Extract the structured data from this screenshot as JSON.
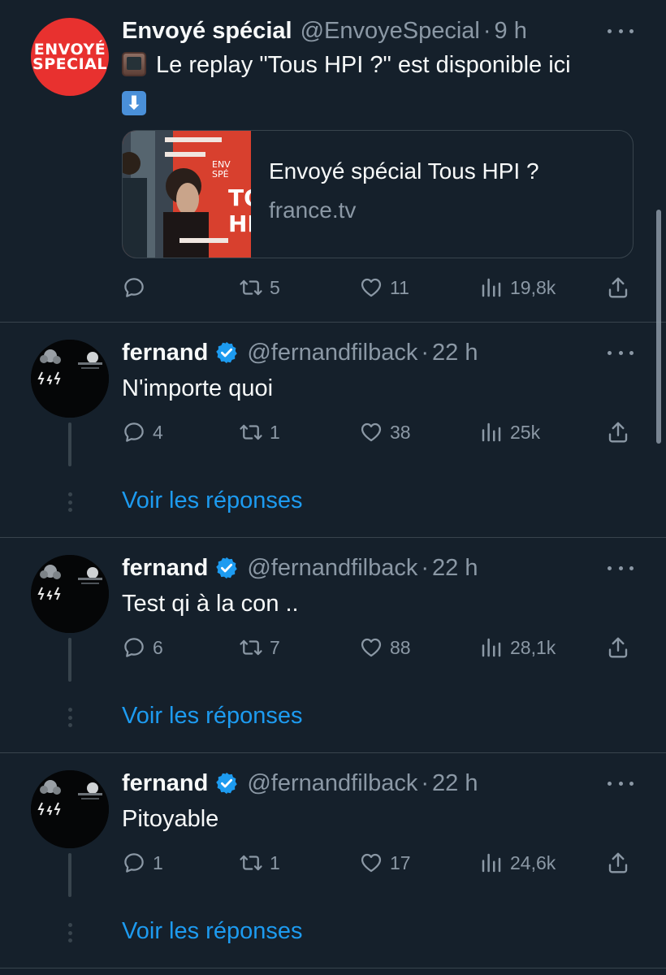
{
  "tweet": {
    "author_name": "Envoyé spécial",
    "handle": "@EnvoyeSpecial",
    "dot": "·",
    "time": "9 h",
    "avatar_text": [
      "ENVOYÉ",
      "SPECIAL"
    ],
    "text": "Le replay \"Tous HPI ?\" est disponible ici",
    "emoji_tv_icon": "television-icon",
    "emoji_arrow": "⬇",
    "card": {
      "title": "Envoyé spécial Tous HPI ?",
      "domain": "france.tv",
      "thumb_text": [
        "ENV",
        "SPÉ",
        "TO",
        "HP"
      ]
    },
    "stats": {
      "replies": "",
      "retweets": "5",
      "likes": "11",
      "views": "19,8k"
    }
  },
  "replies": [
    {
      "author_name": "fernand",
      "handle": "@fernandfilback",
      "dot": "·",
      "time": "22 h",
      "text": "N'importe quoi",
      "stats": {
        "replies": "4",
        "retweets": "1",
        "likes": "38",
        "views": "25k"
      },
      "show_replies": "Voir les réponses"
    },
    {
      "author_name": "fernand",
      "handle": "@fernandfilback",
      "dot": "·",
      "time": "22 h",
      "text": "Test qi à la con ..",
      "stats": {
        "replies": "6",
        "retweets": "7",
        "likes": "88",
        "views": "28,1k"
      },
      "show_replies": "Voir les réponses"
    },
    {
      "author_name": "fernand",
      "handle": "@fernandfilback",
      "dot": "·",
      "time": "22 h",
      "text": "Pitoyable",
      "stats": {
        "replies": "1",
        "retweets": "1",
        "likes": "17",
        "views": "24,6k"
      },
      "show_replies": "Voir les réponses"
    }
  ],
  "colors": {
    "background": "#15202b",
    "text": "#f7f9f9",
    "muted": "#8b98a5",
    "link": "#1d9bf0",
    "verified": "#1d9bf0",
    "border": "#38444d",
    "brand_red": "#e8312f"
  }
}
